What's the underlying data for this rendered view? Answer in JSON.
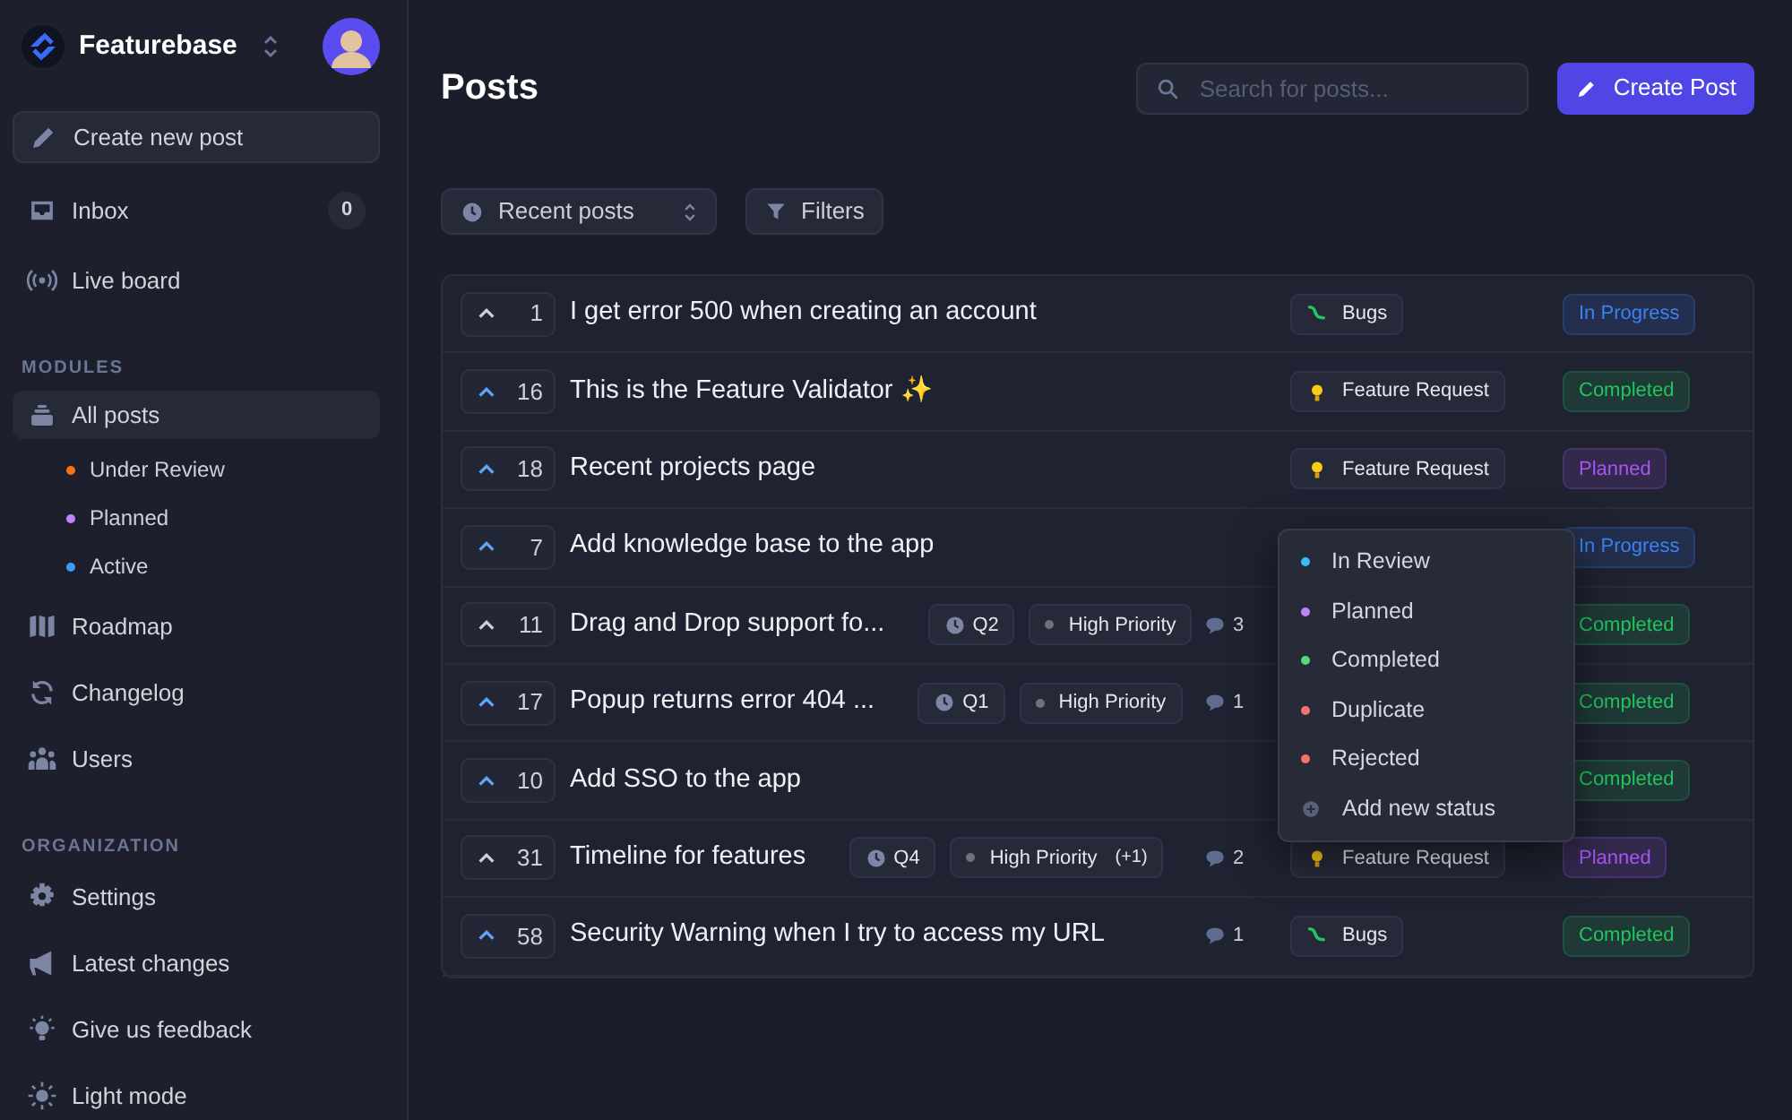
{
  "workspace": {
    "name": "Featurebase"
  },
  "sidebar": {
    "create_label": "Create new post",
    "sections": [
      {
        "items": [
          {
            "label": "Inbox",
            "selected": false,
            "badge": "0"
          },
          {
            "label": "Live board",
            "selected": false
          }
        ]
      },
      {
        "heading": "MODULES",
        "items": [
          {
            "label": "All posts",
            "selected": true,
            "children": [
              {
                "label": "Under Review",
                "color": "#f97316"
              },
              {
                "label": "Planned",
                "color": "#c084fc"
              },
              {
                "label": "Active",
                "color": "#3b9cf6"
              }
            ]
          },
          {
            "label": "Roadmap",
            "selected": false
          },
          {
            "label": "Changelog",
            "selected": false
          },
          {
            "label": "Users",
            "selected": false
          }
        ]
      },
      {
        "heading": "ORGANIZATION",
        "items": [
          {
            "label": "Settings",
            "selected": false
          },
          {
            "label": "Latest changes",
            "selected": false
          },
          {
            "label": "Give us feedback",
            "selected": false
          },
          {
            "label": "Light mode",
            "selected": false
          }
        ]
      }
    ]
  },
  "page": {
    "title": "Posts",
    "search": {
      "placeholder": "Search for posts..."
    },
    "create_button": "Create Post",
    "sort": "Recent posts",
    "filters": "Filters"
  },
  "posts": [
    {
      "votes": "1",
      "voted": false,
      "title": "I get error 500 when creating an account",
      "tag": {
        "label": "Bugs",
        "kind": "bug"
      },
      "status": {
        "label": "In Progress",
        "color": "#3b82f6"
      }
    },
    {
      "votes": "16",
      "voted": true,
      "title": "This is the Feature Validator ✨",
      "tag": {
        "label": "Feature Request",
        "kind": "idea"
      },
      "status": {
        "label": "Completed",
        "color": "#22c55e"
      }
    },
    {
      "votes": "18",
      "voted": true,
      "title": "Recent projects page",
      "tag": {
        "label": "Feature Request",
        "kind": "idea"
      },
      "status": {
        "label": "Planned",
        "color": "#a855f7"
      }
    },
    {
      "votes": "7",
      "voted": true,
      "title": "Add knowledge base to the app",
      "status": {
        "label": "In Progress",
        "color": "#3b82f6"
      }
    },
    {
      "votes": "11",
      "voted": false,
      "title": "Drag and Drop support fo...",
      "eta": "Q2",
      "priority": "High Priority",
      "comments": "3",
      "status": {
        "label": "Completed",
        "color": "#22c55e"
      }
    },
    {
      "votes": "17",
      "voted": true,
      "title": "Popup returns error 404 ...",
      "eta": "Q1",
      "priority": "High Priority",
      "comments": "1",
      "status": {
        "label": "Completed",
        "color": "#22c55e"
      }
    },
    {
      "votes": "10",
      "voted": true,
      "title": "Add SSO to the app",
      "status": {
        "label": "Completed",
        "color": "#22c55e"
      }
    },
    {
      "votes": "31",
      "voted": false,
      "title": "Timeline for features",
      "eta": "Q4",
      "priority": "High Priority",
      "priority_extra": "(+1)",
      "comments": "2",
      "tag": {
        "label": "Feature Request",
        "kind": "idea"
      },
      "status": {
        "label": "Planned",
        "color": "#a855f7"
      }
    },
    {
      "votes": "58",
      "voted": true,
      "title": "Security Warning when I try to access my URL",
      "comments": "1",
      "tag": {
        "label": "Bugs",
        "kind": "bug"
      },
      "status": {
        "label": "Completed",
        "color": "#22c55e"
      }
    }
  ],
  "status_menu": {
    "options": [
      {
        "label": "In Review",
        "color": "#38bdf8"
      },
      {
        "label": "Planned",
        "color": "#c084fc"
      },
      {
        "label": "Completed",
        "color": "#4ade80"
      },
      {
        "label": "Duplicate",
        "color": "#f87171"
      },
      {
        "label": "Rejected",
        "color": "#f87171"
      }
    ],
    "add_label": "Add new status"
  }
}
